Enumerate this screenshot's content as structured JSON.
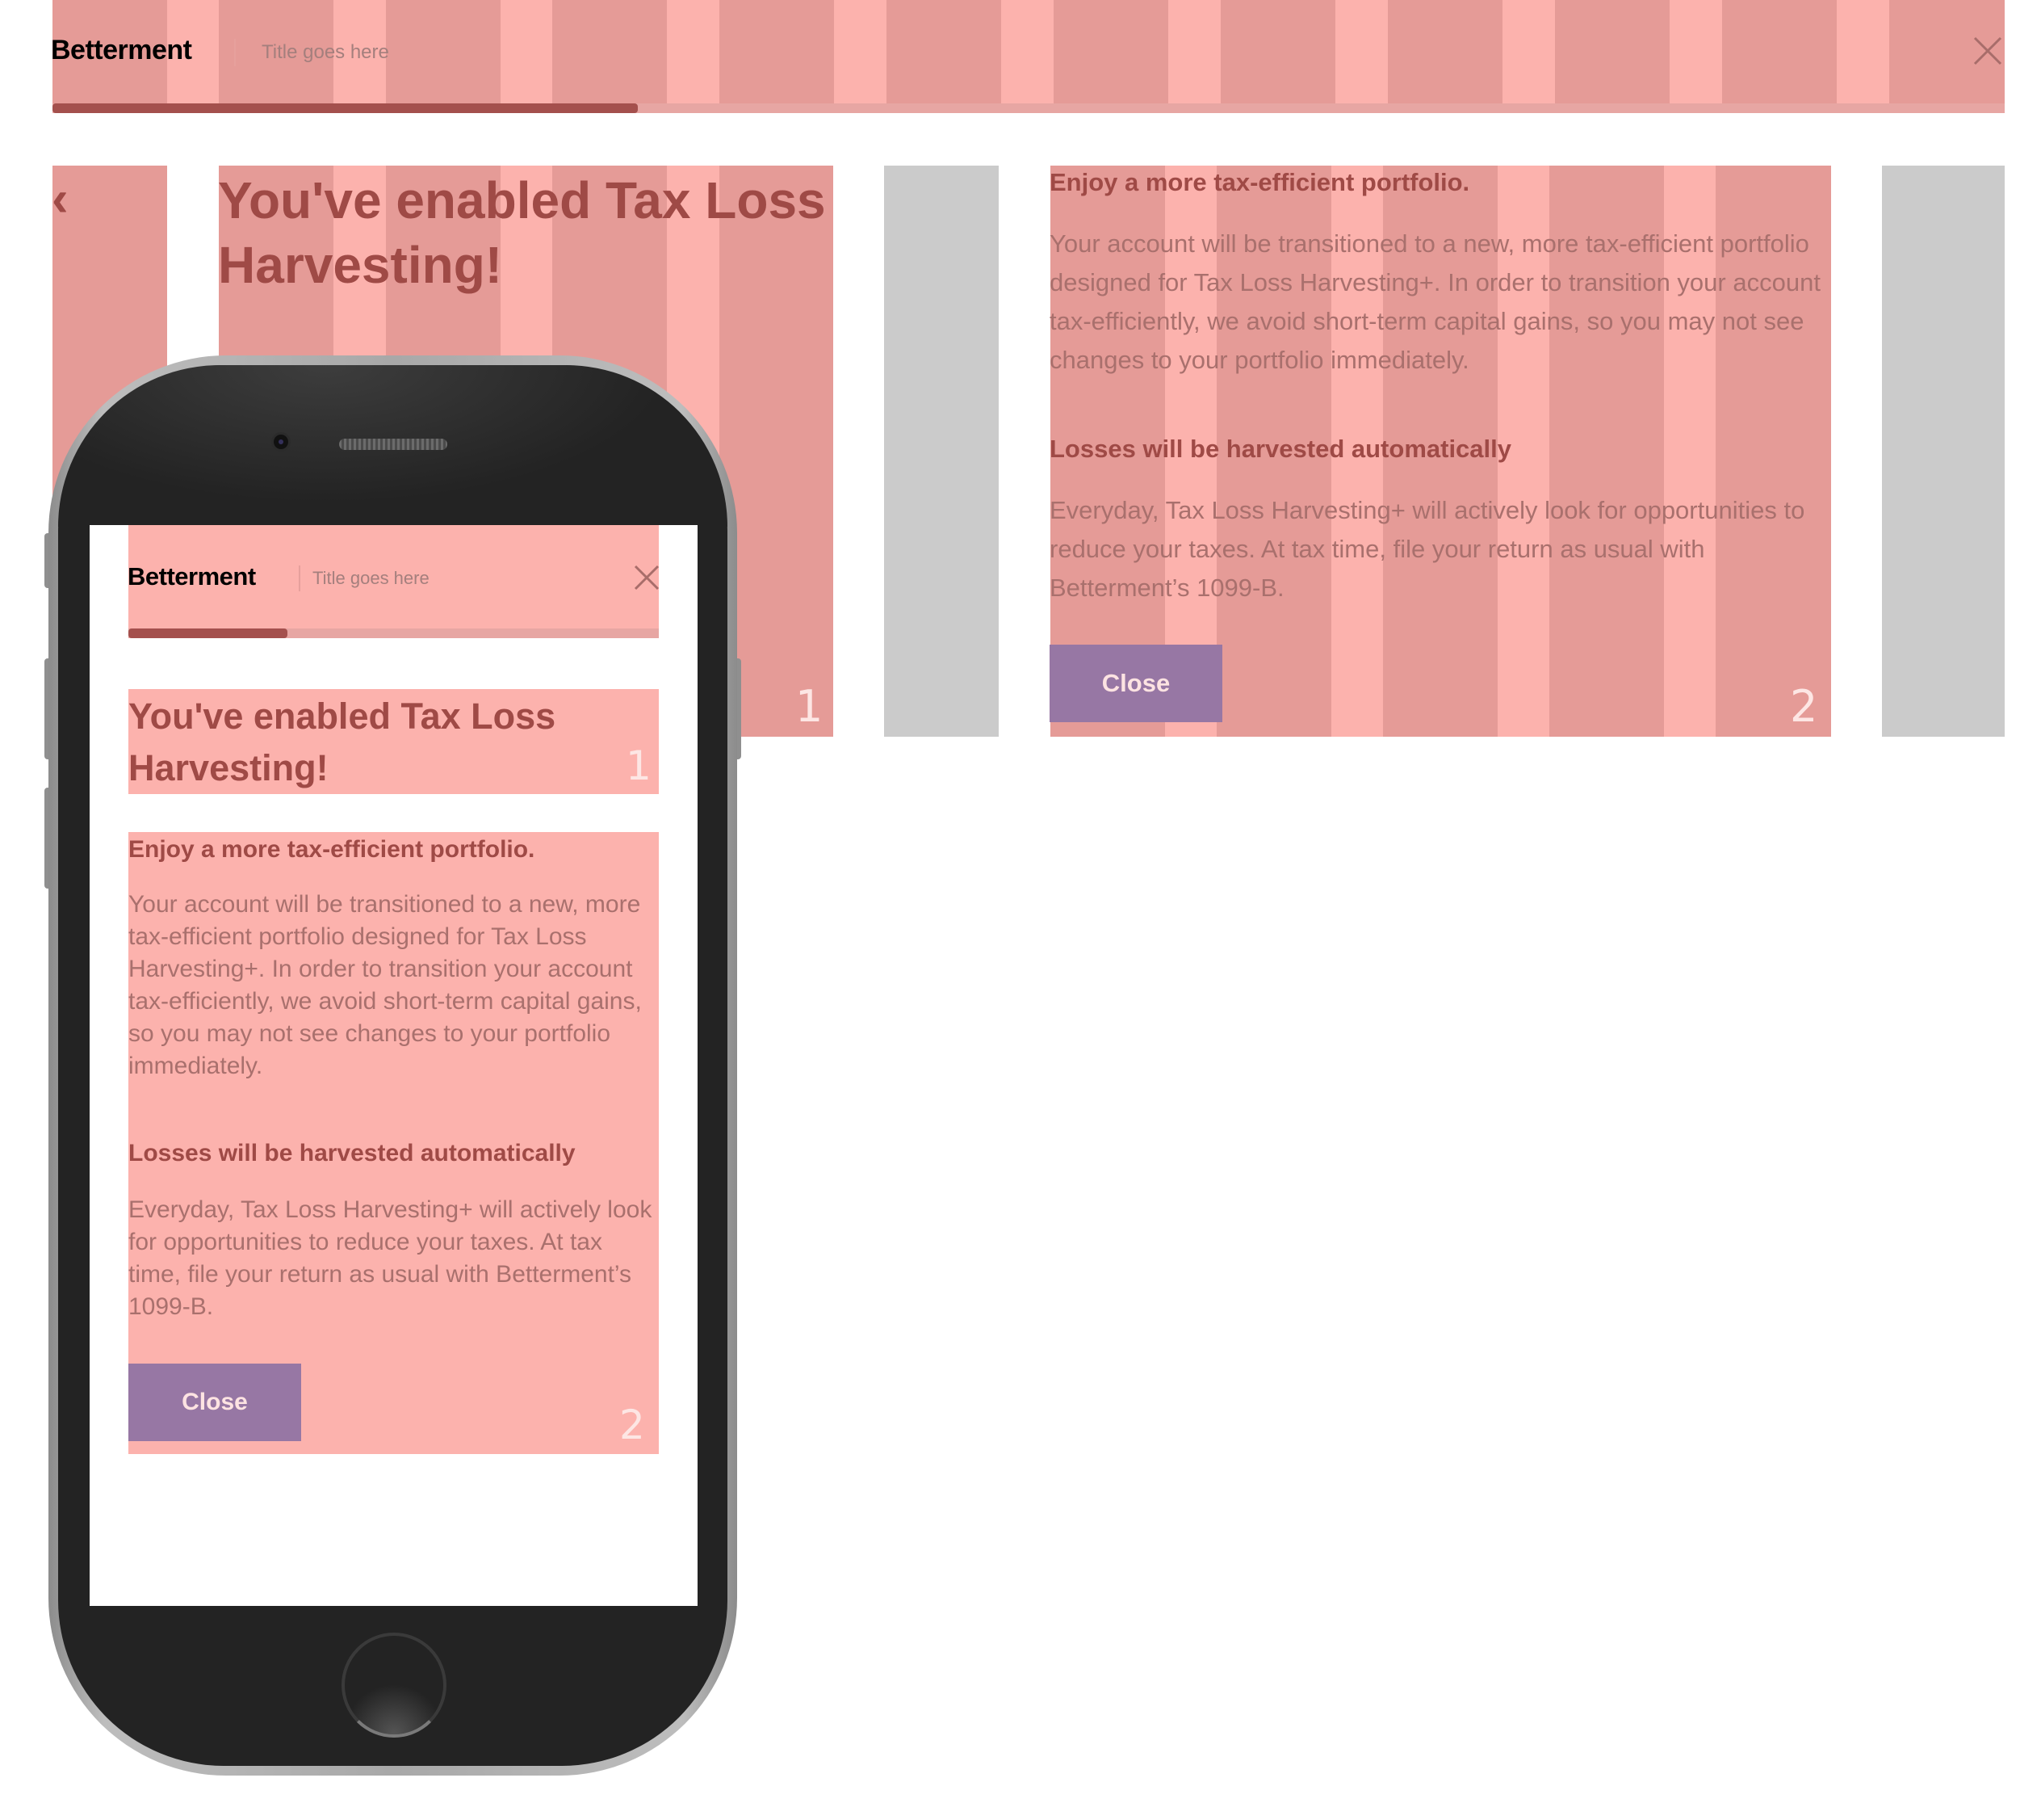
{
  "desktop": {
    "header": {
      "logo": "Betterment",
      "title": "Title goes here",
      "progress": 0.3
    },
    "back_chevron": "‹",
    "hero_title": "You've enabled Tax Loss Harvesting!",
    "column_numbers": [
      "1",
      "2"
    ],
    "content": {
      "section1_heading": "Enjoy a more tax-efficient portfolio.",
      "section1_body": "Your account will be transitioned to a new, more tax-efficient portfolio designed for Tax Loss Harvesting+. In order to transition your account tax-efficiently, we avoid short-term capital gains, so you may not see changes to your portfolio immediately.",
      "section2_heading": "Losses will be harvested automatically",
      "section2_body": "Everyday, Tax Loss Harvesting+ will actively look for opportunities to reduce your taxes. At tax time, file your return as usual with Betterment’s 1099-B.",
      "close_button": "Close"
    }
  },
  "mobile": {
    "header": {
      "logo": "Betterment",
      "title": "Title goes here",
      "progress": 0.3
    },
    "hero_title": "You've enabled Tax Loss Harvesting!",
    "column_numbers": [
      "1",
      "2"
    ],
    "content": {
      "section1_heading": "Enjoy a more tax-efficient portfolio.",
      "section1_body": "Your account will be transitioned to a new, more tax-efficient portfolio designed for Tax Loss Harvesting+. In order to transition your account tax-efficiently, we avoid short-term capital gains, so you may not see changes to your portfolio immediately.",
      "section2_heading": "Losses will be harvested automatically",
      "section2_body": "Everyday, Tax Loss Harvesting+ will actively look for opportunities to reduce your taxes. At tax time, file your return as usual with Betterment’s 1099-B.",
      "close_button": "Close"
    }
  },
  "colors": {
    "grid_light": "#fcb2ad",
    "grid_dark": "#e59b97",
    "grid_grey": "#cbcbcb",
    "heading": "#9f4a46",
    "body": "#a9706d",
    "button": "#9777a4",
    "progress_fill": "#a4504d"
  },
  "icons": {
    "close": "close-icon",
    "back": "chevron-left-icon"
  }
}
